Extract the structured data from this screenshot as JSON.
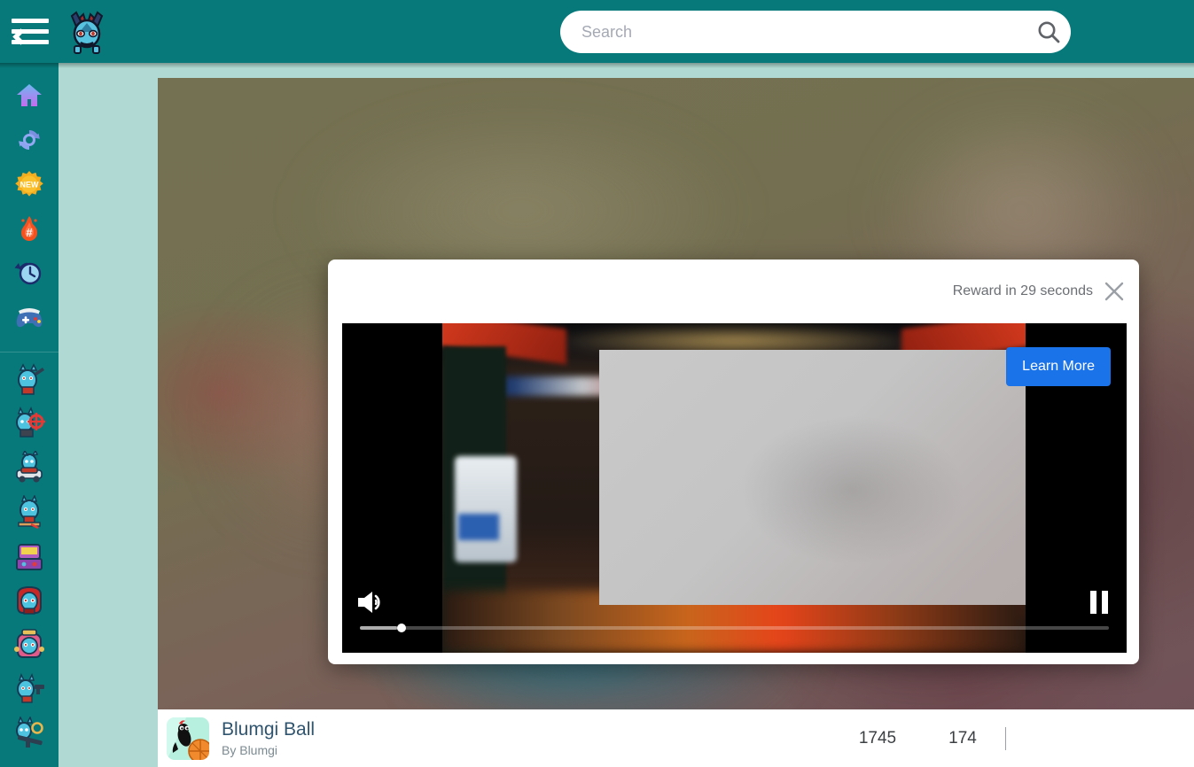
{
  "header": {
    "menu_icon": "hamburger-back-icon",
    "logo_icon": "blumgi-dragon-logo",
    "search": {
      "placeholder": "Search",
      "value": "",
      "icon": "search-icon"
    },
    "bg_color": "#07797a"
  },
  "sidebar": {
    "nav_items": [
      {
        "name": "home",
        "icon": "home-icon",
        "label": "Home"
      },
      {
        "name": "updated",
        "icon": "refresh-icon",
        "label": "Updated"
      },
      {
        "name": "new",
        "icon": "new-badge-icon",
        "label": "NEW"
      },
      {
        "name": "trending",
        "icon": "flame-hash-icon",
        "label": "Trending"
      },
      {
        "name": "recent",
        "icon": "clock-history-icon",
        "label": "Recently played"
      },
      {
        "name": "all-games",
        "icon": "gamepad-icon",
        "label": "All games"
      }
    ],
    "game_items": [
      {
        "name": "game-thumb-1",
        "icon": "blumgi-rocket-icon"
      },
      {
        "name": "game-thumb-2",
        "icon": "blumgi-target-icon"
      },
      {
        "name": "game-thumb-3",
        "icon": "blumgi-car-icon"
      },
      {
        "name": "game-thumb-4",
        "icon": "blumgi-slime-icon"
      },
      {
        "name": "game-thumb-5",
        "icon": "blumgi-arcade-icon"
      },
      {
        "name": "game-thumb-6",
        "icon": "blumgi-red-icon"
      },
      {
        "name": "game-thumb-7",
        "icon": "blumgi-pink-icon"
      },
      {
        "name": "game-thumb-8",
        "icon": "blumgi-gun-icon"
      },
      {
        "name": "game-thumb-9",
        "icon": "blumgi-sniper-icon"
      }
    ]
  },
  "ad": {
    "reward_text": "Reward in 29 seconds",
    "close_icon": "close-icon",
    "learn_more_label": "Learn More",
    "learn_more_color": "#1a73e8",
    "volume_icon": "volume-on-icon",
    "pause_icon": "pause-icon",
    "progress_percent": 5
  },
  "game_info": {
    "thumb_icon": "blumgi-ball-thumb",
    "title": "Blumgi Ball",
    "author": "By Blumgi",
    "stats": [
      {
        "name": "plays-count",
        "value": "1745"
      },
      {
        "name": "likes-count",
        "value": "174"
      }
    ]
  },
  "page": {
    "background_color": "#afd9d2"
  }
}
